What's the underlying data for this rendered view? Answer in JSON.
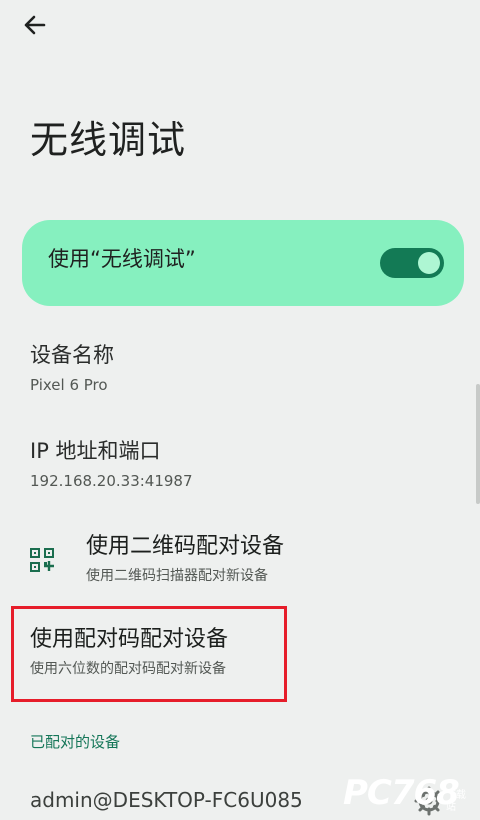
{
  "page": {
    "title": "无线调试"
  },
  "toggle": {
    "label": "使用“无线调试”",
    "enabled": true
  },
  "device_name": {
    "title": "设备名称",
    "value": "Pixel 6 Pro"
  },
  "ip_address": {
    "title": "IP 地址和端口",
    "value": "192.168.20.33:41987"
  },
  "pair_qr": {
    "title": "使用二维码配对设备",
    "subtitle": "使用二维码扫描器配对新设备"
  },
  "pair_code": {
    "title": "使用配对码配对设备",
    "subtitle": "使用六位数的配对码配对新设备"
  },
  "paired_devices": {
    "header": "已配对的设备",
    "items": [
      {
        "name": "admin@DESKTOP-FC6U085"
      }
    ]
  },
  "watermark": {
    "main": "PC768",
    "sub": "下载站"
  },
  "icons": {
    "back": "arrow-back-icon",
    "qr": "qr-code-icon",
    "settings": "gear-icon"
  },
  "colors": {
    "background": "#eef0ef",
    "accent_card": "#86f0bf",
    "switch_track": "#137a55",
    "switch_knob": "#aef6d3",
    "highlight_box": "#e61d2a",
    "section_header": "#147658"
  }
}
